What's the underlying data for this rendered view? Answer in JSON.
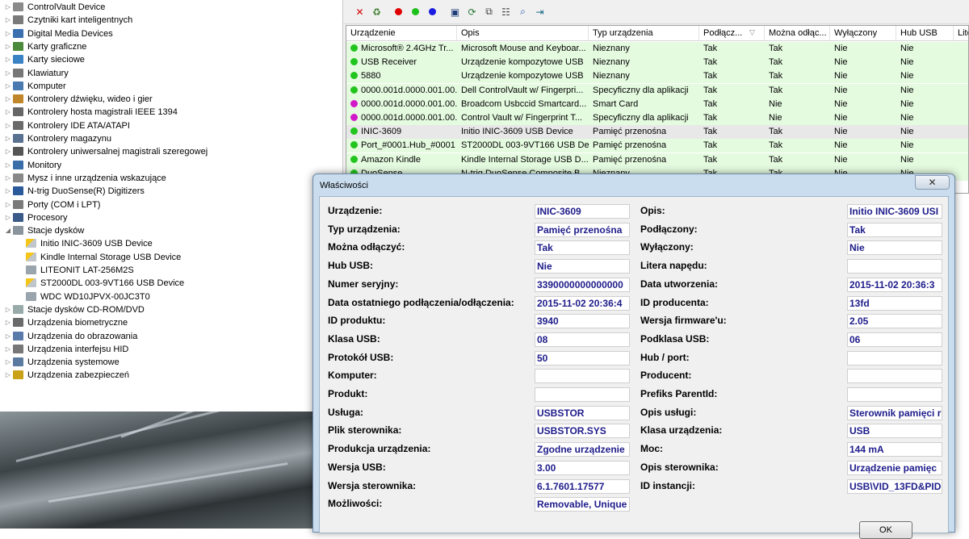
{
  "device_tree": [
    {
      "label": "ControlVault Device",
      "icon": "device-icon",
      "level": 0,
      "expander": "▷"
    },
    {
      "label": "Czytniki kart inteligentnych",
      "icon": "smartcard-reader-icon",
      "level": 0,
      "expander": "▷"
    },
    {
      "label": "Digital Media Devices",
      "icon": "media-device-icon",
      "level": 0,
      "expander": "▷"
    },
    {
      "label": "Karty graficzne",
      "icon": "display-adapter-icon",
      "level": 0,
      "expander": "▷"
    },
    {
      "label": "Karty sieciowe",
      "icon": "network-adapter-icon",
      "level": 0,
      "expander": "▷"
    },
    {
      "label": "Klawiatury",
      "icon": "keyboard-icon",
      "level": 0,
      "expander": "▷"
    },
    {
      "label": "Komputer",
      "icon": "computer-icon",
      "level": 0,
      "expander": "▷"
    },
    {
      "label": "Kontrolery dźwięku, wideo i gier",
      "icon": "sound-icon",
      "level": 0,
      "expander": "▷"
    },
    {
      "label": "Kontrolery hosta magistrali IEEE 1394",
      "icon": "ieee1394-icon",
      "level": 0,
      "expander": "▷"
    },
    {
      "label": "Kontrolery IDE ATA/ATAPI",
      "icon": "ide-controller-icon",
      "level": 0,
      "expander": "▷"
    },
    {
      "label": "Kontrolery magazynu",
      "icon": "storage-controller-icon",
      "level": 0,
      "expander": "▷"
    },
    {
      "label": "Kontrolery uniwersalnej magistrali szeregowej",
      "icon": "usb-controller-icon",
      "level": 0,
      "expander": "▷"
    },
    {
      "label": "Monitory",
      "icon": "monitor-icon",
      "level": 0,
      "expander": "▷"
    },
    {
      "label": "Mysz i inne urządzenia wskazujące",
      "icon": "mouse-icon",
      "level": 0,
      "expander": "▷"
    },
    {
      "label": "N-trig DuoSense(R) Digitizers",
      "icon": "digitizer-icon",
      "level": 0,
      "expander": "▷"
    },
    {
      "label": "Porty (COM i LPT)",
      "icon": "port-icon",
      "level": 0,
      "expander": "▷"
    },
    {
      "label": "Procesory",
      "icon": "processor-icon",
      "level": 0,
      "expander": "▷"
    },
    {
      "label": "Stacje dysków",
      "icon": "disk-drive-icon",
      "level": 0,
      "expander": "◢"
    },
    {
      "label": "Initio INIC-3609 USB Device",
      "icon": "warning-drive-icon",
      "level": 1,
      "expander": ""
    },
    {
      "label": "Kindle Internal Storage USB Device",
      "icon": "warning-drive-icon",
      "level": 1,
      "expander": ""
    },
    {
      "label": "LITEONIT LAT-256M2S",
      "icon": "drive-icon",
      "level": 1,
      "expander": ""
    },
    {
      "label": "ST2000DL 003-9VT166 USB Device",
      "icon": "warning-drive-icon",
      "level": 1,
      "expander": ""
    },
    {
      "label": "WDC WD10JPVX-00JC3T0",
      "icon": "drive-icon",
      "level": 1,
      "expander": ""
    },
    {
      "label": "Stacje dysków CD-ROM/DVD",
      "icon": "cdrom-icon",
      "level": 0,
      "expander": "▷"
    },
    {
      "label": "Urządzenia biometryczne",
      "icon": "biometric-icon",
      "level": 0,
      "expander": "▷"
    },
    {
      "label": "Urządzenia do obrazowania",
      "icon": "imaging-icon",
      "level": 0,
      "expander": "▷"
    },
    {
      "label": "Urządzenia interfejsu HID",
      "icon": "hid-icon",
      "level": 0,
      "expander": "▷"
    },
    {
      "label": "Urządzenia systemowe",
      "icon": "system-device-icon",
      "level": 0,
      "expander": "▷"
    },
    {
      "label": "Urządzenia zabezpieczeń",
      "icon": "security-device-icon",
      "level": 0,
      "expander": "▷"
    }
  ],
  "toolbar_icons": [
    "delete-icon",
    "uninstall-icon",
    "red-filter-icon",
    "green-filter-icon",
    "blue-filter-icon",
    "save-icon",
    "refresh-icon",
    "copy-icon",
    "properties-icon",
    "find-icon",
    "exit-icon"
  ],
  "table": {
    "columns": [
      "Urządzenie",
      "Opis",
      "Typ urządzenia",
      "Podłącz...",
      "Można odłąc...",
      "Wyłączony",
      "Hub USB",
      "Lite"
    ],
    "rows": [
      {
        "status": "#22c41e",
        "highlight": "#e5fbe0",
        "cells": [
          "Microsoft® 2.4GHz Tr...",
          "Microsoft Mouse and Keyboar...",
          "Nieznany",
          "Tak",
          "Tak",
          "Nie",
          "Nie",
          ""
        ]
      },
      {
        "status": "#22c41e",
        "highlight": "#e5fbe0",
        "cells": [
          "USB Receiver",
          "Urządzenie kompozytowe USB",
          "Nieznany",
          "Tak",
          "Tak",
          "Nie",
          "Nie",
          ""
        ]
      },
      {
        "status": "#22c41e",
        "highlight": "#e5fbe0",
        "cells": [
          "5880",
          "Urządzenie kompozytowe USB",
          "Nieznany",
          "Tak",
          "Tak",
          "Nie",
          "Nie",
          ""
        ]
      },
      {
        "status": "#22c41e",
        "highlight": "#e5fbe0",
        "cells": [
          "0000.001d.0000.001.00...",
          "Dell ControlVault w/ Fingerpri...",
          "Specyficzny dla aplikacji",
          "Tak",
          "Tak",
          "Nie",
          "Nie",
          ""
        ]
      },
      {
        "status": "#d218c9",
        "highlight": "#e5fbe0",
        "cells": [
          "0000.001d.0000.001.00...",
          "Broadcom Usbccid Smartcard...",
          "Smart Card",
          "Tak",
          "Nie",
          "Nie",
          "Nie",
          ""
        ]
      },
      {
        "status": "#d218c9",
        "highlight": "#e5fbe0",
        "cells": [
          "0000.001d.0000.001.00...",
          "Control Vault w/ Fingerprint T...",
          "Specyficzny dla aplikacji",
          "Tak",
          "Nie",
          "Nie",
          "Nie",
          ""
        ]
      },
      {
        "status": "#22c41e",
        "highlight": "#e8e8e8",
        "cells": [
          "INIC-3609",
          "Initio INIC-3609 USB Device",
          "Pamięć przenośna",
          "Tak",
          "Tak",
          "Nie",
          "Nie",
          ""
        ]
      },
      {
        "status": "#22c41e",
        "highlight": "#e5fbe0",
        "cells": [
          "Port_#0001.Hub_#0001",
          "ST2000DL 003-9VT166 USB De...",
          "Pamięć przenośna",
          "Tak",
          "Tak",
          "Nie",
          "Nie",
          ""
        ]
      },
      {
        "status": "#22c41e",
        "highlight": "#e5fbe0",
        "cells": [
          "Amazon Kindle",
          "Kindle Internal Storage USB D...",
          "Pamięć przenośna",
          "Tak",
          "Tak",
          "Nie",
          "Nie",
          ""
        ]
      },
      {
        "status": "#22c41e",
        "highlight": "#e5fbe0",
        "cells": [
          "DuoSense",
          "N-trig DuoSense Composite B...",
          "Nieznany",
          "Tak",
          "Tak",
          "Nie",
          "Nie",
          ""
        ]
      }
    ]
  },
  "dialog": {
    "title": "Właściwości",
    "close_glyph": "✕",
    "ok_label": "OK",
    "left": [
      {
        "label": "Urządzenie:",
        "value": "INIC-3609"
      },
      {
        "label": "Typ urządzenia:",
        "value": "Pamięć przenośna"
      },
      {
        "label": "Można odłączyć:",
        "value": "Tak"
      },
      {
        "label": "Hub USB:",
        "value": "Nie"
      },
      {
        "label": "Numer seryjny:",
        "value": "3390000000000000"
      },
      {
        "label": "Data ostatniego podłączenia/odłączenia:",
        "value": "2015-11-02 20:36:4"
      },
      {
        "label": "ID produktu:",
        "value": "3940"
      },
      {
        "label": "Klasa USB:",
        "value": "08"
      },
      {
        "label": "Protokół USB:",
        "value": "50"
      },
      {
        "label": "Komputer:",
        "value": ""
      },
      {
        "label": "Produkt:",
        "value": ""
      },
      {
        "label": "Usługa:",
        "value": "USBSTOR"
      },
      {
        "label": "Plik sterownika:",
        "value": "USBSTOR.SYS"
      },
      {
        "label": "Produkcja urządzenia:",
        "value": "Zgodne urządzenie"
      },
      {
        "label": "Wersja USB:",
        "value": "3.00"
      },
      {
        "label": "Wersja sterownika:",
        "value": "6.1.7601.17577"
      },
      {
        "label": "Możliwości:",
        "value": "Removable, Unique"
      }
    ],
    "right": [
      {
        "label": "Opis:",
        "value": "Initio INIC-3609 USI"
      },
      {
        "label": "Podłączony:",
        "value": "Tak"
      },
      {
        "label": "Wyłączony:",
        "value": "Nie"
      },
      {
        "label": "Litera napędu:",
        "value": ""
      },
      {
        "label": "Data utworzenia:",
        "value": "2015-11-02 20:36:3"
      },
      {
        "label": "ID producenta:",
        "value": "13fd"
      },
      {
        "label": "Wersja firmware'u:",
        "value": "2.05"
      },
      {
        "label": "Podklasa USB:",
        "value": "06"
      },
      {
        "label": "Hub / port:",
        "value": ""
      },
      {
        "label": "Producent:",
        "value": ""
      },
      {
        "label": "Prefiks ParentId:",
        "value": ""
      },
      {
        "label": "Opis usługi:",
        "value": "Sterownik pamięci r"
      },
      {
        "label": "Klasa urządzenia:",
        "value": "USB"
      },
      {
        "label": "Moc:",
        "value": "144 mA"
      },
      {
        "label": "Opis sterownika:",
        "value": "Urządzenie pamięc"
      },
      {
        "label": "ID instancji:",
        "value": "USB\\VID_13FD&PID"
      }
    ]
  }
}
